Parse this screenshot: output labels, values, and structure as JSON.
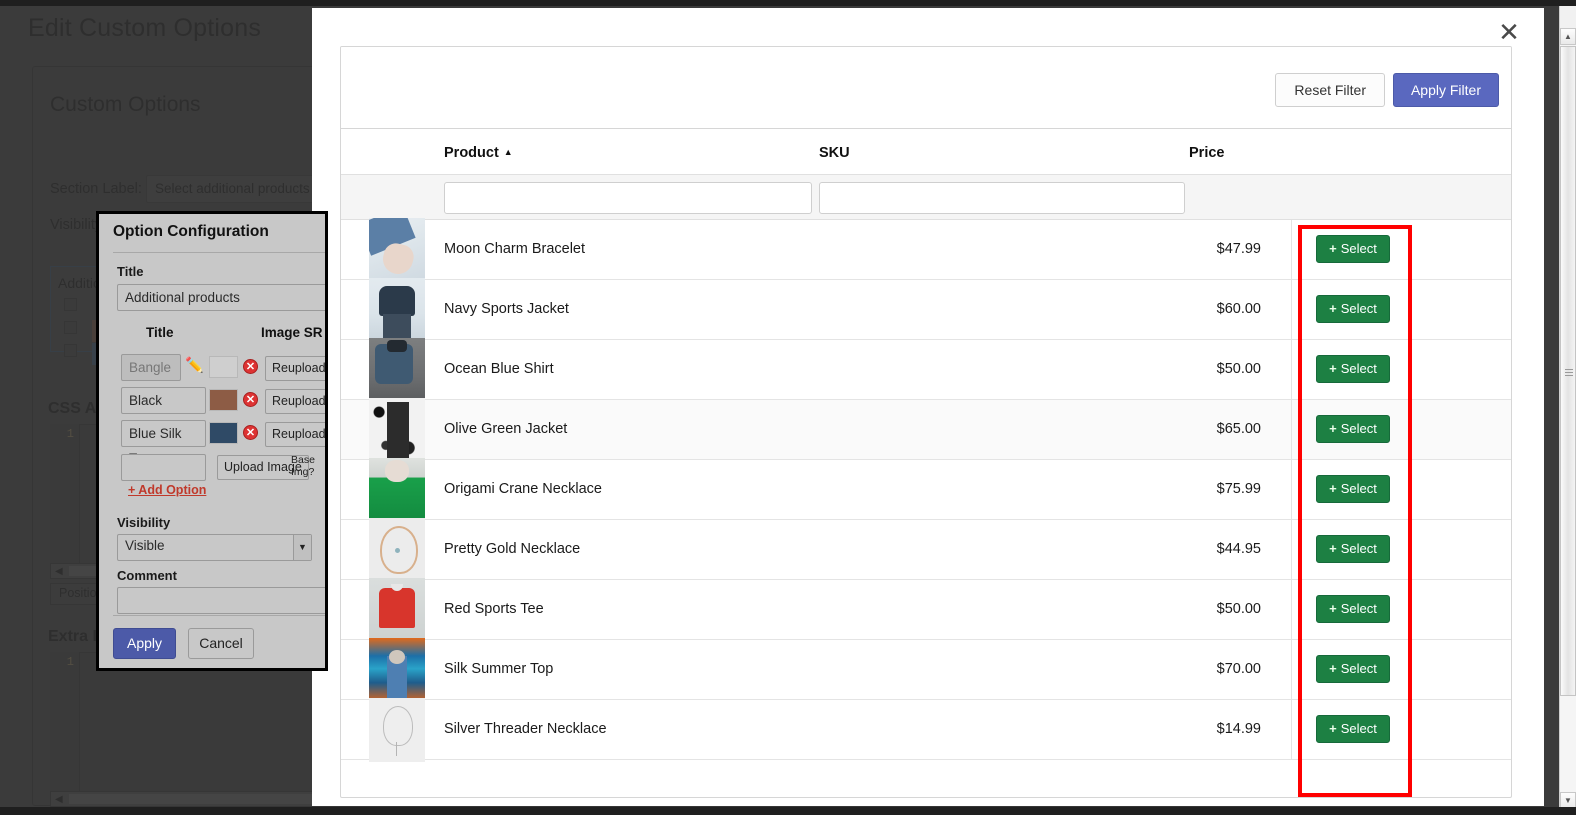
{
  "background_page": {
    "page_title": "Edit Custom Options",
    "section_heading": "Custom Options",
    "section_label_caption": "Section Label:",
    "section_label_value": "Select additional products",
    "visibility_caption": "Visibility:",
    "option_group_title": "Additional products",
    "css_heading": "CSS Ad",
    "extra_heading": "Extra I",
    "code_line_number": "1",
    "position_tab": "Position"
  },
  "option_dialog": {
    "title": "Option Configuration",
    "title_field_label": "Title",
    "title_field_value": "Additional products",
    "columns": {
      "title": "Title",
      "image_src": "Image SR"
    },
    "rows": [
      {
        "title": "Bangle Br",
        "reupload_label": "Reupload",
        "delete_icon": "delete-circle-icon",
        "edit_icon": "pencil-icon",
        "disabled": true
      },
      {
        "title": "Black Leather",
        "reupload_label": "Reupload",
        "delete_icon": "delete-circle-icon",
        "disabled": false
      },
      {
        "title": "Blue Silk Tuxe",
        "reupload_label": "Reupload",
        "delete_icon": "delete-circle-icon",
        "disabled": false
      }
    ],
    "new_row": {
      "title_value": "",
      "upload_button": "Upload Image",
      "base_img_text_line1": "Base",
      "base_img_text_line2": "Img?"
    },
    "add_option_link": "+ Add Option",
    "visibility_label": "Visibility",
    "visibility_value": "Visible",
    "comment_label": "Comment",
    "comment_value": "",
    "apply_button": "Apply",
    "cancel_button": "Cancel"
  },
  "modal": {
    "close_icon": "close-icon",
    "reset_filter_button": "Reset Filter",
    "apply_filter_button": "Apply Filter",
    "accent_color": "#5a68bf",
    "select_button_color": "#1d8043",
    "annotation_color": "#ff0000",
    "table": {
      "headers": {
        "product": "Product",
        "sku": "SKU",
        "price": "Price"
      },
      "sort_column": "Product",
      "sort_direction": "asc",
      "sort_caret": "▲",
      "filters": {
        "product_value": "",
        "sku_value": "",
        "product_placeholder": "",
        "sku_placeholder": ""
      },
      "select_button_label": "Select",
      "select_button_plus": "+",
      "rows": [
        {
          "product": "Moon Charm Bracelet",
          "sku": "",
          "price": "$47.99",
          "thumb": "p1",
          "alt": false
        },
        {
          "product": "Navy Sports Jacket",
          "sku": "",
          "price": "$60.00",
          "thumb": "p2",
          "alt": false
        },
        {
          "product": "Ocean Blue Shirt",
          "sku": "",
          "price": "$50.00",
          "thumb": "p3",
          "alt": false
        },
        {
          "product": "Olive Green Jacket",
          "sku": "",
          "price": "$65.00",
          "thumb": "p4",
          "alt": true
        },
        {
          "product": "Origami Crane Necklace",
          "sku": "",
          "price": "$75.99",
          "thumb": "p5",
          "alt": false
        },
        {
          "product": "Pretty Gold Necklace",
          "sku": "",
          "price": "$44.95",
          "thumb": "p6",
          "alt": false
        },
        {
          "product": "Red Sports Tee",
          "sku": "",
          "price": "$50.00",
          "thumb": "p7",
          "alt": false
        },
        {
          "product": "Silk Summer Top",
          "sku": "",
          "price": "$70.00",
          "thumb": "p8",
          "alt": false
        },
        {
          "product": "Silver Threader Necklace",
          "sku": "",
          "price": "$14.99",
          "thumb": "p9",
          "alt": false
        }
      ]
    }
  },
  "scrollbar": {
    "up_arrow": "▲",
    "down_arrow": "▼"
  }
}
